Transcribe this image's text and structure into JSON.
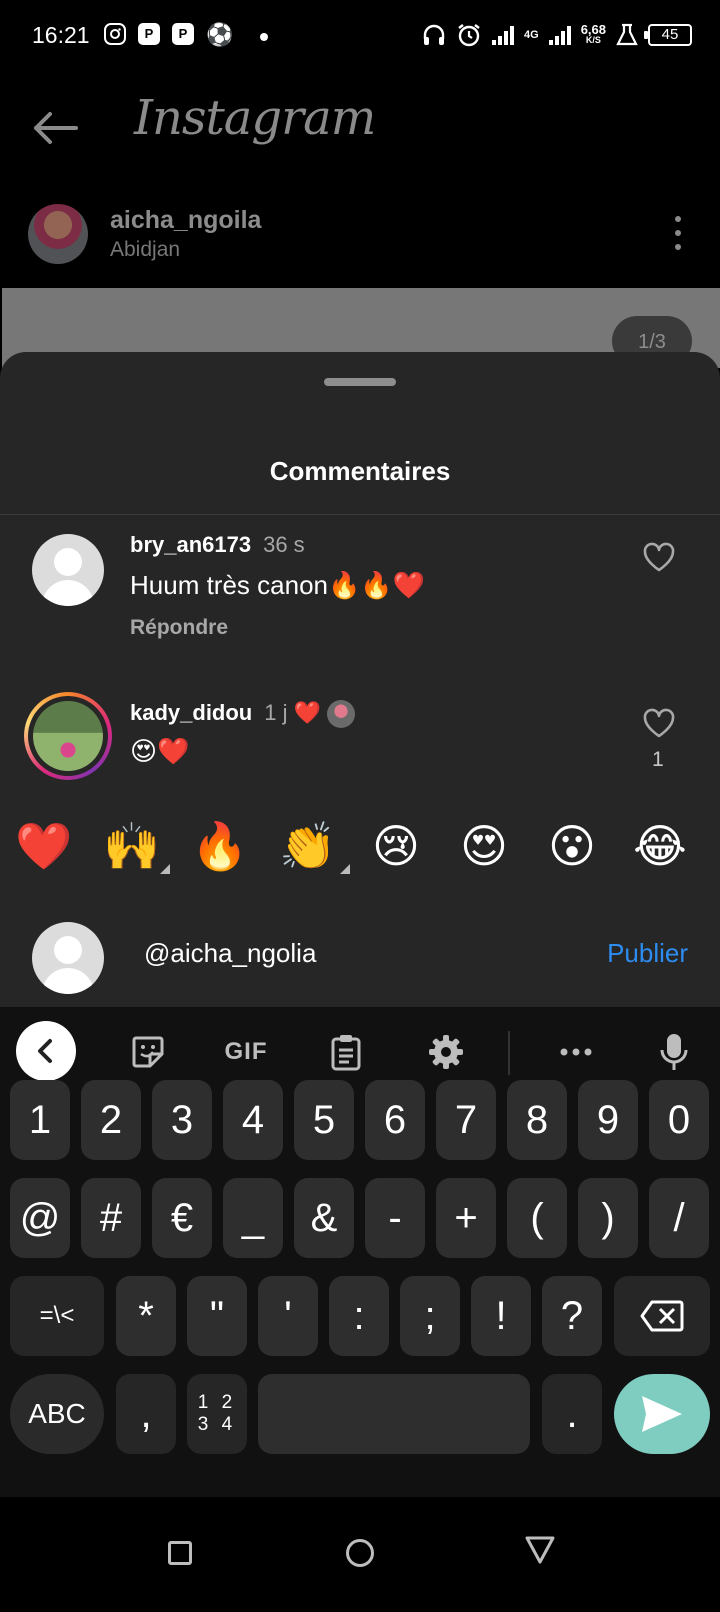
{
  "status_bar": {
    "time": "16:21",
    "network_label": "4G",
    "speed_value": "6,68",
    "speed_unit": "K/S",
    "battery": "45"
  },
  "app": {
    "title": "Instagram"
  },
  "post": {
    "username": "aicha_ngoila",
    "location": "Abidjan",
    "image_counter": "1/3"
  },
  "comments_sheet": {
    "title": "Commentaires",
    "comments": [
      {
        "username": "bry_an6173",
        "time": "36 s",
        "text": "Huum très canon🔥🔥❤️",
        "reply_label": "Répondre"
      },
      {
        "username": "kady_didou",
        "time": "1 j",
        "time_badge": "❤️",
        "text": "😍❤️",
        "like_count": "1"
      }
    ]
  },
  "emoji_bar": [
    "❤️",
    "🙌",
    "🔥",
    "👏",
    "😢",
    "😍",
    "😮",
    "😂"
  ],
  "composer": {
    "value": "@aicha_ngolia",
    "publish_label": "Publier"
  },
  "keyboard": {
    "toolbar": {
      "gif_label": "GIF"
    },
    "row1": [
      "1",
      "2",
      "3",
      "4",
      "5",
      "6",
      "7",
      "8",
      "9",
      "0"
    ],
    "row2": [
      "@",
      "#",
      "€",
      "_",
      "&",
      "-",
      "+",
      "(",
      ")",
      "/"
    ],
    "row3": [
      "=\\<",
      "*",
      "\"",
      "'",
      ":",
      ";",
      "!",
      "?"
    ],
    "row4": {
      "abc_label": "ABC",
      "comma": ",",
      "numpad_top": "1 2",
      "numpad_bottom": "3 4",
      "period": "."
    }
  },
  "colors": {
    "sheet_bg": "#262626",
    "accent_blue": "#2d8cf0",
    "send_key": "#7fcdc0",
    "key_bg": "#2e2e2e"
  }
}
